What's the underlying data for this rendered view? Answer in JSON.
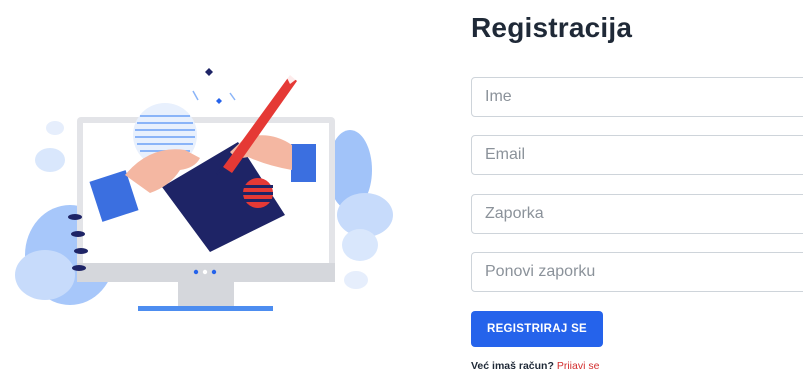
{
  "form": {
    "title": "Registracija",
    "fields": {
      "name": {
        "placeholder": "Ime",
        "value": ""
      },
      "email": {
        "placeholder": "Email",
        "value": ""
      },
      "password": {
        "placeholder": "Zaporka",
        "value": ""
      },
      "confirm_password": {
        "placeholder": "Ponovi zaporku",
        "value": ""
      }
    },
    "submit_label": "REGISTRIRAJ SE",
    "login_prompt": "Već imaš račun?",
    "login_link": "Prijavi se"
  },
  "colors": {
    "primary": "#2563eb",
    "link": "#d32f2f",
    "title": "#1f2937",
    "navy": "#1e2466",
    "light_blue": "#8ab4f8",
    "accent_red": "#e53935"
  },
  "icons": {
    "illustration": "monitor-with-hands-drawing-illustration"
  }
}
